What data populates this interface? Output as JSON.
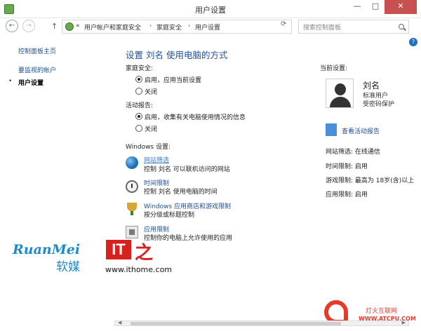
{
  "window": {
    "title": "用户设置",
    "minimize": "—",
    "maximize": "□",
    "close": "✕"
  },
  "nav": {
    "back": "←",
    "forward": "→",
    "up": "↑",
    "overflow": "«",
    "breadcrumbs": [
      "用户帐户和家庭安全",
      "家庭安全",
      "用户设置"
    ],
    "separator": "›",
    "dropdown": "⌄",
    "refresh": "⟳",
    "search_placeholder": "搜索控制面板"
  },
  "help": "?",
  "sidebar": {
    "items": [
      {
        "label": "控制面板主页"
      },
      {
        "label": "要监视的帐户"
      },
      {
        "label": "用户设置",
        "current": true
      }
    ],
    "bullet": "•"
  },
  "main": {
    "title": "设置 刘名 使用电脑的方式",
    "family_safety": {
      "label": "家庭安全:",
      "options": [
        "启用，应用当前设置",
        "关闭"
      ],
      "selected": 0
    },
    "activity_report": {
      "label": "活动报告:",
      "options": [
        "启用，收集有关电脑使用情况的信息",
        "关闭"
      ],
      "selected": 0
    },
    "windows_settings": {
      "label": "Windows 设置:",
      "items": [
        {
          "icon": "globe-icon",
          "link": "网站筛选",
          "desc": "控制 刘名 可以联机访问的网站"
        },
        {
          "icon": "clock-icon",
          "link": "时间限制",
          "desc": "控制 刘名 使用电脑的时间"
        },
        {
          "icon": "trophy-icon",
          "link": "Windows 应用商店和游戏限制",
          "desc": "按分级或标题控制"
        },
        {
          "icon": "apps-icon",
          "link": "应用限制",
          "desc": "控制你的电脑上允许使用的应用"
        }
      ]
    }
  },
  "current_settings": {
    "label": "当前设置:",
    "user": {
      "name": "刘名",
      "role": "标准用户",
      "protection": "受密码保护"
    },
    "report_link": "查看活动报告",
    "rows": [
      "网站筛选: 在线通信",
      "时间限制: 启用",
      "游戏限制: 最高为 18岁(含)以上",
      "应用限制: 启用"
    ]
  },
  "watermarks": {
    "ruanmei": "RuanMei",
    "ruanmei_cn": "软媒",
    "it": "IT",
    "zhi": "之",
    "ithome": "www.ithome.com",
    "atcpu_cn": "灯火互联网",
    "atcpu": "WWW.ATCPU.COM"
  },
  "colors": {
    "link": "#1e4f92",
    "close_button": "#c75050",
    "accent_red": "#d7211e",
    "accent_blue": "#1d8bc9"
  }
}
